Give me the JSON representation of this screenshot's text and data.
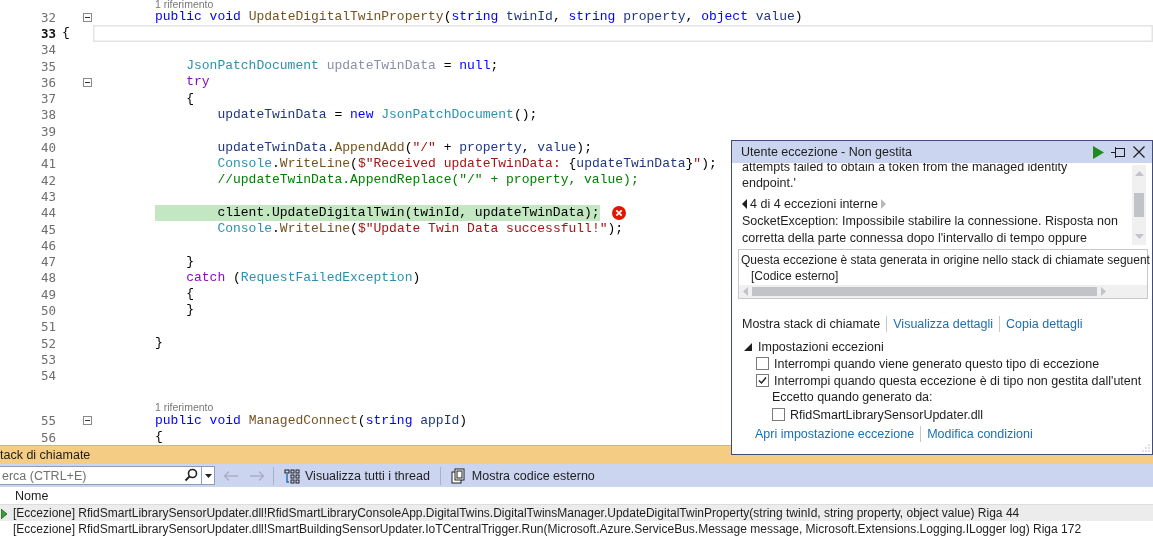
{
  "editor": {
    "lines": [
      {
        "kind": "lens",
        "text": "1 riferimento"
      },
      {
        "kind": "code",
        "number": "32",
        "foldable": true,
        "tokens": [
          {
            "kind": "kw",
            "text": "public void "
          },
          {
            "kind": "method",
            "text": "UpdateDigitalTwinProperty"
          },
          {
            "kind": "punct",
            "text": "("
          },
          {
            "kind": "kw",
            "text": "string "
          },
          {
            "kind": "ident",
            "text": "twinId"
          },
          {
            "kind": "punct",
            "text": ", "
          },
          {
            "kind": "kw",
            "text": "string "
          },
          {
            "kind": "ident",
            "text": "property"
          },
          {
            "kind": "punct",
            "text": ", "
          },
          {
            "kind": "kw",
            "text": "object "
          },
          {
            "kind": "ident",
            "text": "value"
          },
          {
            "kind": "punct",
            "text": ")"
          }
        ]
      },
      {
        "kind": "code",
        "number": "33",
        "current": true,
        "tokens": [
          {
            "kind": "punct",
            "text": "{"
          }
        ]
      },
      {
        "kind": "code",
        "number": "34"
      },
      {
        "kind": "code",
        "number": "35",
        "tokens": [
          {
            "kind": "type",
            "text": "    JsonPatchDocument "
          },
          {
            "kind": "dim",
            "text": "updateTwinData"
          },
          {
            "kind": "punct",
            "text": " = "
          },
          {
            "kind": "kw",
            "text": "null"
          },
          {
            "kind": "punct",
            "text": ";"
          }
        ]
      },
      {
        "kind": "code",
        "number": "36",
        "foldable": true,
        "tokens": [
          {
            "kind": "ctrl",
            "text": "    try"
          }
        ]
      },
      {
        "kind": "code",
        "number": "37",
        "tokens": [
          {
            "kind": "punct",
            "text": "    {"
          }
        ]
      },
      {
        "kind": "code",
        "number": "38",
        "tokens": [
          {
            "kind": "ident",
            "text": "        updateTwinData"
          },
          {
            "kind": "punct",
            "text": " = "
          },
          {
            "kind": "kw",
            "text": "new "
          },
          {
            "kind": "type",
            "text": "JsonPatchDocument"
          },
          {
            "kind": "punct",
            "text": "();"
          }
        ]
      },
      {
        "kind": "code",
        "number": "39"
      },
      {
        "kind": "code",
        "number": "40",
        "tokens": [
          {
            "kind": "ident",
            "text": "        updateTwinData"
          },
          {
            "kind": "punct",
            "text": "."
          },
          {
            "kind": "method",
            "text": "AppendAdd"
          },
          {
            "kind": "punct",
            "text": "("
          },
          {
            "kind": "str",
            "text": "\"/\""
          },
          {
            "kind": "punct",
            "text": " + "
          },
          {
            "kind": "ident",
            "text": "property"
          },
          {
            "kind": "punct",
            "text": ", "
          },
          {
            "kind": "ident",
            "text": "value"
          },
          {
            "kind": "punct",
            "text": ");"
          }
        ]
      },
      {
        "kind": "code",
        "number": "41",
        "tokens": [
          {
            "kind": "type",
            "text": "        Console"
          },
          {
            "kind": "punct",
            "text": "."
          },
          {
            "kind": "method",
            "text": "WriteLine"
          },
          {
            "kind": "punct",
            "text": "("
          },
          {
            "kind": "str",
            "text": "$\"Received updateTwinData: "
          },
          {
            "kind": "punct",
            "text": "{"
          },
          {
            "kind": "ident",
            "text": "updateTwinData"
          },
          {
            "kind": "punct",
            "text": "}"
          },
          {
            "kind": "str",
            "text": "\""
          },
          {
            "kind": "punct",
            "text": ");"
          }
        ]
      },
      {
        "kind": "code",
        "number": "42",
        "tokens": [
          {
            "kind": "comment",
            "text": "        //updateTwinData.AppendReplace(\"/\" + property, value);"
          }
        ]
      },
      {
        "kind": "code",
        "number": "43"
      },
      {
        "kind": "code",
        "number": "44",
        "highlighted": true,
        "error": true,
        "tokens": [
          {
            "kind": "punct",
            "text": "        client.UpdateDigitalTwin(twinId, updateTwinData);"
          }
        ]
      },
      {
        "kind": "code",
        "number": "45",
        "tokens": [
          {
            "kind": "type",
            "text": "        Console"
          },
          {
            "kind": "punct",
            "text": "."
          },
          {
            "kind": "method",
            "text": "WriteLine"
          },
          {
            "kind": "punct",
            "text": "("
          },
          {
            "kind": "str",
            "text": "$\"Update Twin Data successfull!\""
          },
          {
            "kind": "punct",
            "text": ");"
          }
        ]
      },
      {
        "kind": "code",
        "number": "46"
      },
      {
        "kind": "code",
        "number": "47",
        "tokens": [
          {
            "kind": "punct",
            "text": "    }"
          }
        ]
      },
      {
        "kind": "code",
        "number": "48",
        "tokens": [
          {
            "kind": "ctrl",
            "text": "    catch "
          },
          {
            "kind": "punct",
            "text": "("
          },
          {
            "kind": "type",
            "text": "RequestFailedException"
          },
          {
            "kind": "punct",
            "text": ")"
          }
        ]
      },
      {
        "kind": "code",
        "number": "49",
        "tokens": [
          {
            "kind": "punct",
            "text": "    {"
          }
        ]
      },
      {
        "kind": "code",
        "number": "50",
        "tokens": [
          {
            "kind": "punct",
            "text": "    }"
          }
        ]
      },
      {
        "kind": "code",
        "number": "51"
      },
      {
        "kind": "code",
        "number": "52",
        "tokens": [
          {
            "kind": "punct",
            "text": "}"
          }
        ]
      },
      {
        "kind": "code",
        "number": "53"
      },
      {
        "kind": "code",
        "number": "54"
      },
      {
        "kind": "lens",
        "text": "1 riferimento"
      },
      {
        "kind": "code",
        "number": "55",
        "foldable": true,
        "tokens": [
          {
            "kind": "kw",
            "text": "public void "
          },
          {
            "kind": "method",
            "text": "ManagedConnect"
          },
          {
            "kind": "punct",
            "text": "("
          },
          {
            "kind": "kw",
            "text": "string "
          },
          {
            "kind": "ident",
            "text": "appId"
          },
          {
            "kind": "punct",
            "text": ")"
          }
        ]
      },
      {
        "kind": "code",
        "number": "56",
        "tokens": [
          {
            "kind": "punct",
            "text": "{"
          }
        ]
      }
    ]
  },
  "exception_popup": {
    "title": "Utente eccezione - Non gestita",
    "message_lines": [
      "attempts failed to obtain a token from the managed identity",
      "endpoint.'"
    ],
    "inner_nav": "4 di 4 eccezioni interne",
    "detail_lines": [
      "SocketException: Impossibile stabilire la connessione. Risposta non",
      "corretta della parte connessa dopo l'intervallo di tempo oppure"
    ],
    "origin_lines": [
      "Questa eccezione è stata generata in origine nello stack di chiamate seguent",
      "[Codice esterno]"
    ],
    "links": [
      {
        "label": "Mostra stack di chiamate",
        "kind": "plain"
      },
      {
        "label": "Visualizza dettagli",
        "kind": "link"
      },
      {
        "label": "Copia dettagli",
        "kind": "link"
      }
    ],
    "settings": {
      "label": "Impostazioni eccezioni",
      "expanded": true,
      "options": [
        {
          "kind": "checkbox",
          "label": "Interrompi quando viene generato questo tipo di eccezione",
          "checked": false
        },
        {
          "kind": "checkbox",
          "label": "Interrompi quando questa eccezione è di tipo non gestita dall'utent",
          "checked": true,
          "children": [
            {
              "kind": "label",
              "label": "Eccetto quando generato da:"
            },
            {
              "kind": "checkbox",
              "label": "RfidSmartLibrarySensorUpdater.dll",
              "checked": false
            }
          ]
        }
      ]
    },
    "bottom_links": [
      {
        "label": "Apri impostazione eccezione",
        "kind": "link"
      },
      {
        "label": "Modifica condizioni",
        "kind": "link"
      }
    ]
  },
  "call_stack": {
    "title": "tack di chiamate",
    "search": {
      "placeholder": "erca (CTRL+E)"
    },
    "toolbar": [
      {
        "label": "Visualizza tutti i thread",
        "kind": "threads"
      },
      {
        "label": "Mostra codice esterno",
        "kind": "external"
      }
    ],
    "columns": [
      "Nome"
    ],
    "rows": [
      {
        "text": "[Eccezione] RfidSmartLibrarySensorUpdater.dll!RfidSmartLibraryConsoleApp.DigitalTwins.DigitalTwinsManager.UpdateDigitalTwinProperty(string twinId, string property, object value) Riga 44",
        "selected": true
      },
      {
        "text": "[Eccezione] RfidSmartLibrarySensorUpdater.dll!SmartBuildingSensorUpdater.IoTCentralTrigger.Run(Microsoft.Azure.ServiceBus.Message message, Microsoft.Extensions.Logging.ILogger log) Riga 172",
        "selected": false
      }
    ]
  }
}
